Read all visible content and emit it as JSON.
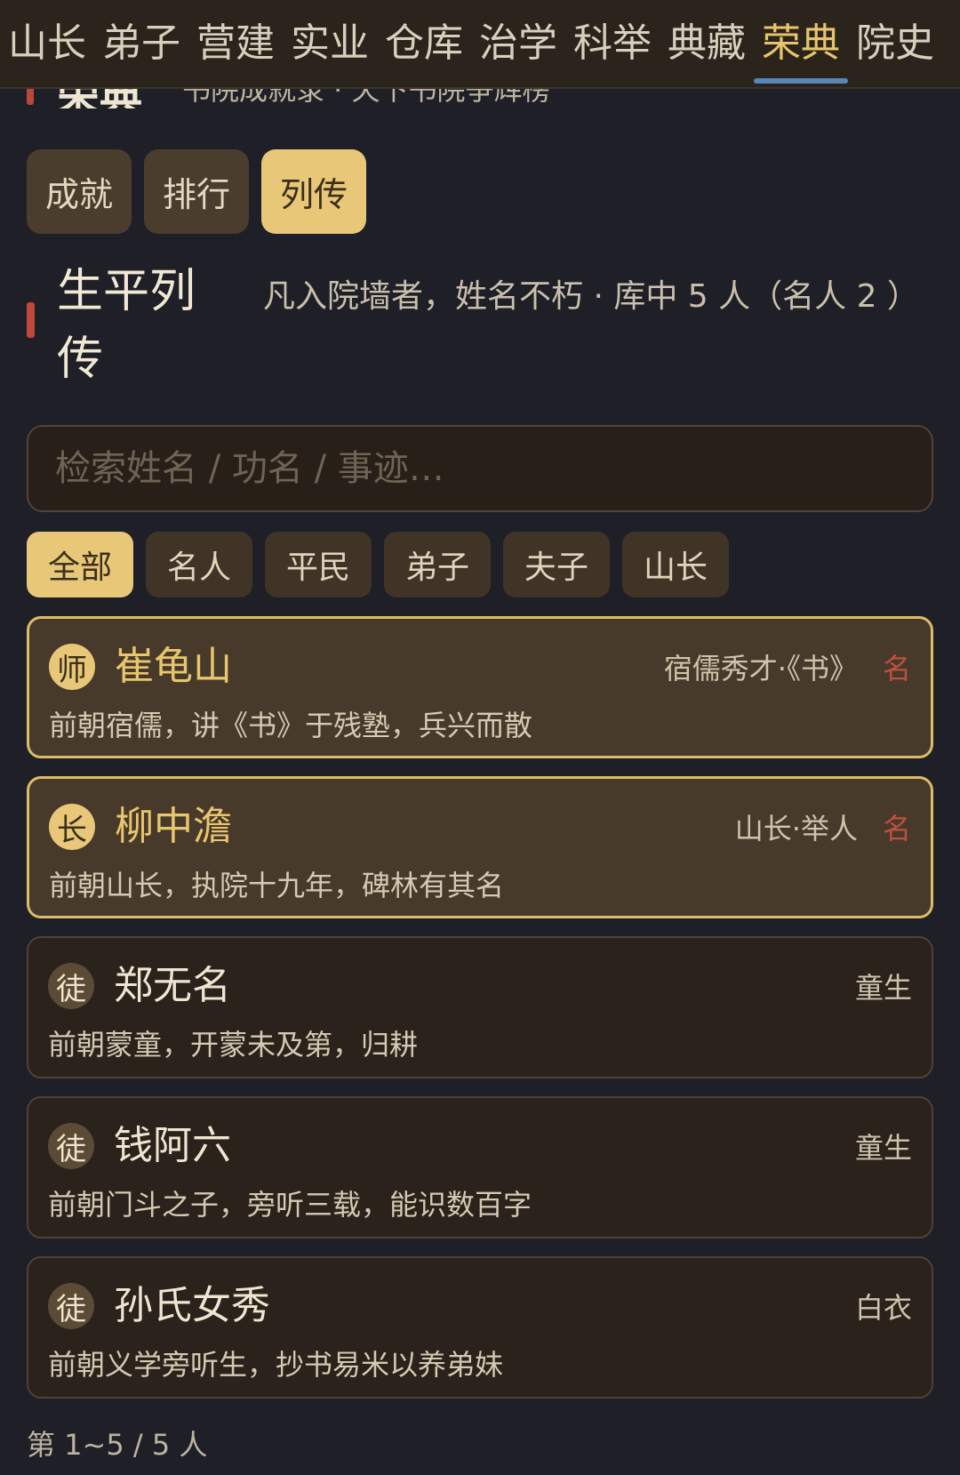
{
  "nav": {
    "tabs": [
      "山长",
      "弟子",
      "营建",
      "实业",
      "仓库",
      "治学",
      "科举",
      "典藏",
      "荣典",
      "院史"
    ],
    "active_index": 8
  },
  "prev_header": {
    "title": "荣典",
    "subtitle": "书院成就录 · 天下书院争辉榜"
  },
  "subtabs": {
    "items": [
      "成就",
      "排行",
      "列传"
    ],
    "active_index": 2
  },
  "section": {
    "title": "生平列传",
    "subtitle": "凡入院墙者，姓名不朽 · 库中 5 人（名人 2 ）"
  },
  "search": {
    "placeholder": "检索姓名 / 功名 / 事迹…",
    "value": ""
  },
  "filters": {
    "items": [
      "全部",
      "名人",
      "平民",
      "弟子",
      "夫子",
      "山长"
    ],
    "active_index": 0
  },
  "people": [
    {
      "badge": "师",
      "name": "崔龟山",
      "title": "宿儒秀才·《书》",
      "fame": "名",
      "desc": "前朝宿儒，讲《书》于残塾，兵兴而散",
      "notable": true
    },
    {
      "badge": "长",
      "name": "柳中澹",
      "title": "山长·举人",
      "fame": "名",
      "desc": "前朝山长，执院十九年，碑林有其名",
      "notable": true
    },
    {
      "badge": "徒",
      "name": "郑无名",
      "title": "童生",
      "fame": "",
      "desc": "前朝蒙童，开蒙未及第，归耕",
      "notable": false
    },
    {
      "badge": "徒",
      "name": "钱阿六",
      "title": "童生",
      "fame": "",
      "desc": "前朝门斗之子，旁听三载，能识数百字",
      "notable": false
    },
    {
      "badge": "徒",
      "name": "孙氏女秀",
      "title": "白衣",
      "fame": "",
      "desc": "前朝义学旁听生，抄书易米以养弟妹",
      "notable": false
    }
  ],
  "footer": {
    "text": "第 1~5 / 5 人"
  },
  "colors": {
    "background": "#1e1f27",
    "accent_gold": "#e8c878",
    "fame_red": "#c0503f",
    "nav_underline": "#5b86b8"
  }
}
